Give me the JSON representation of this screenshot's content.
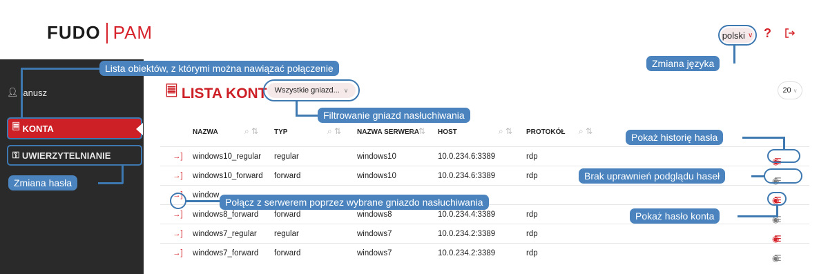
{
  "header": {
    "logo_brand": "FUDO",
    "logo_product": "PAM",
    "language": "polski",
    "icons": [
      "help-icon",
      "logout-icon"
    ]
  },
  "sidebar": {
    "user": "janusz",
    "items": [
      {
        "label": "KONTA",
        "icon": "document-icon",
        "active": true
      },
      {
        "label": "UWIERZYTELNIANIE",
        "icon": "key-icon",
        "active": false
      }
    ]
  },
  "main": {
    "title": "LISTA KONT",
    "listener_filter": "Wszystkie gniazd...",
    "per_page": "20",
    "columns": [
      "NAZWA",
      "TYP",
      "NAZWA SERWERA",
      "HOST",
      "PROTOKÓŁ"
    ],
    "rows": [
      {
        "name": "windows10_regular",
        "type": "regular",
        "server": "windows10",
        "host": "10.0.234.6:3389",
        "protocol": "rdp"
      },
      {
        "name": "windows10_forward",
        "type": "forward",
        "server": "windows10",
        "host": "10.0.234.6:3389",
        "protocol": "rdp"
      },
      {
        "name": "window",
        "type": "",
        "server": "",
        "host": "",
        "protocol": ""
      },
      {
        "name": "windows8_forward",
        "type": "forward",
        "server": "windows8",
        "host": "10.0.234.4:3389",
        "protocol": "rdp"
      },
      {
        "name": "windows7_regular",
        "type": "regular",
        "server": "windows7",
        "host": "10.0.234.2:3389",
        "protocol": "rdp"
      },
      {
        "name": "windows7_forward",
        "type": "forward",
        "server": "windows7",
        "host": "10.0.234.2:3389",
        "protocol": "rdp"
      }
    ]
  },
  "callouts": {
    "object_list": "Lista obiektów, z którymi można nawiązać połączenie",
    "change_language": "Zmiana języka",
    "listener_filter": "Filtrowanie gniazd nasłuchiwania",
    "password_history": "Pokaż historię hasła",
    "no_permission": "Brak uprawnień podglądu haseł",
    "connect": "Połącz z serwerem poprzez wybrane gniazdo nasłuchiwania",
    "show_password": "Pokaż hasło konta",
    "change_password": "Zmiana hasła"
  },
  "colors": {
    "accent": "#cc1f26",
    "callout": "#4a83be",
    "sidebar": "#2a2a2a"
  }
}
